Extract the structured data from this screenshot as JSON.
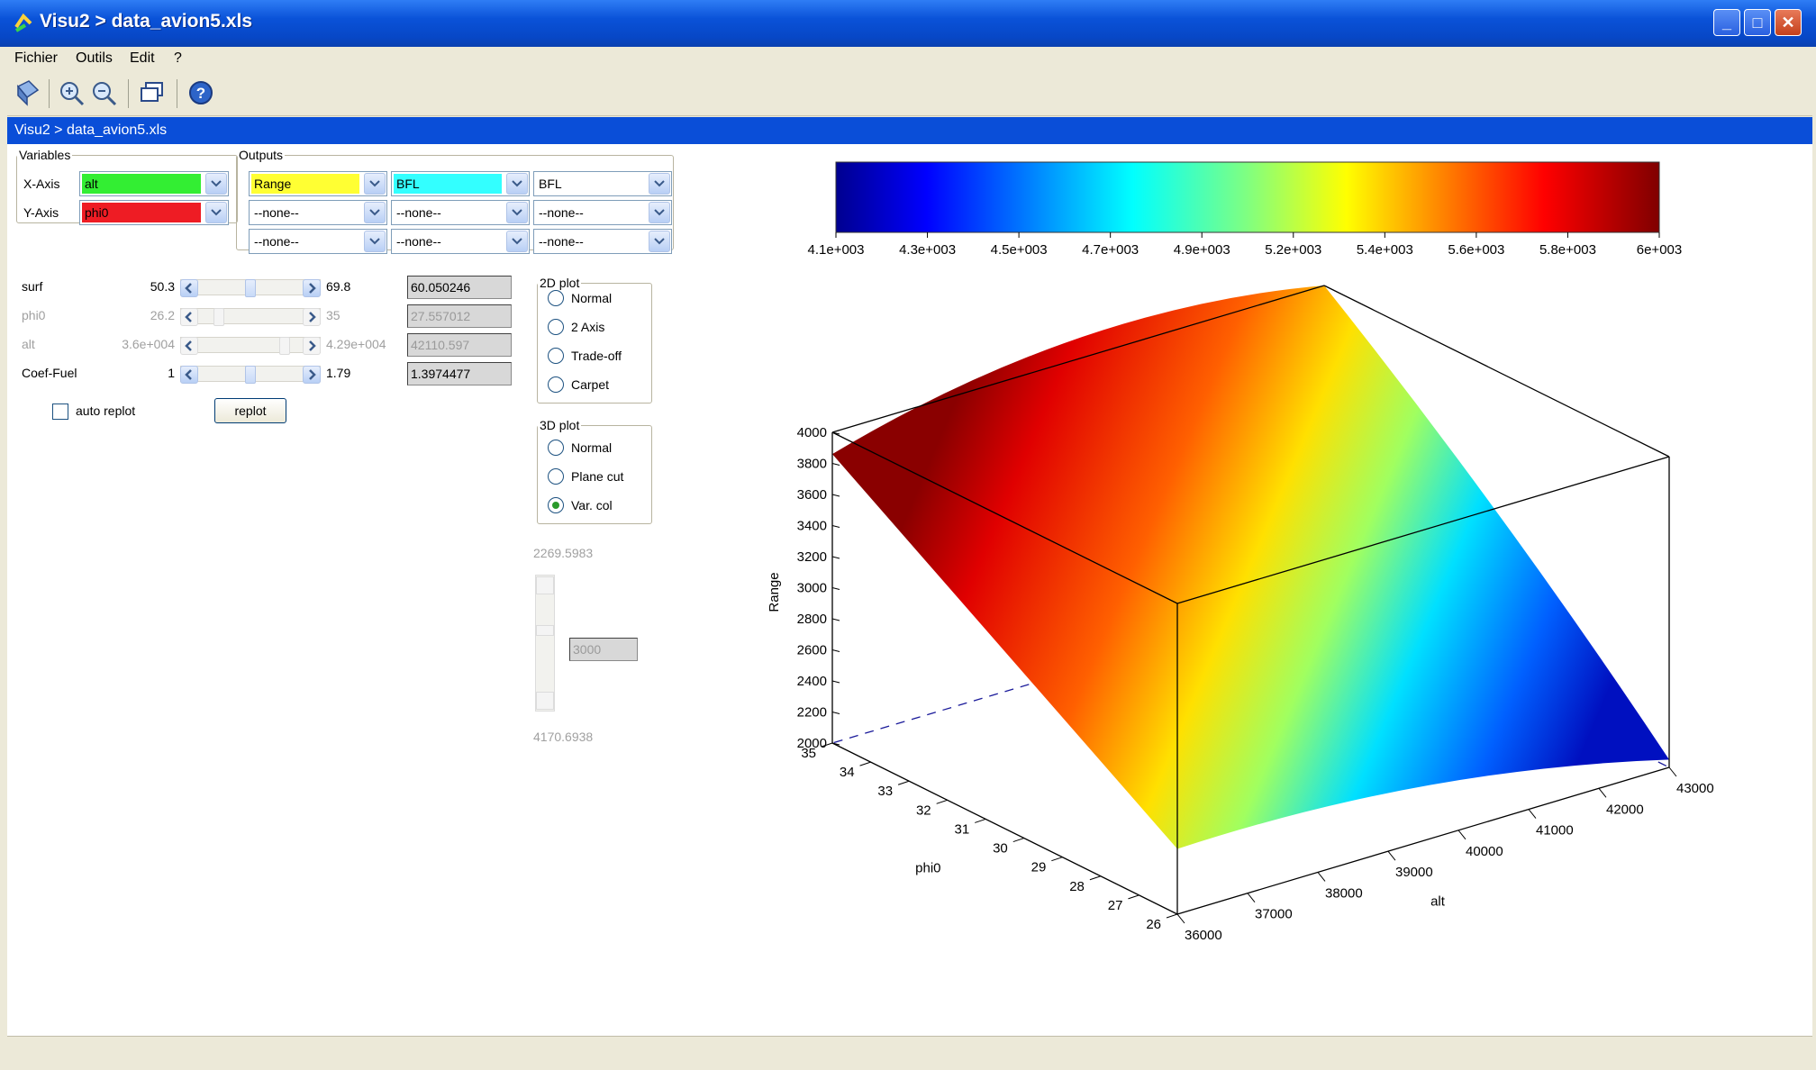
{
  "window": {
    "title": "Visu2 > data_avion5.xls",
    "path_bar": "Visu2 > data_avion5.xls",
    "controls": {
      "minimize": "_",
      "maximize": "□",
      "close": "✕"
    }
  },
  "menu": [
    "Fichier",
    "Outils",
    "Edit",
    "?"
  ],
  "toolbar": {
    "icons": [
      "tool-icon",
      "zoom-in-icon",
      "zoom-out-icon",
      "window-icon",
      "help-icon"
    ]
  },
  "variables": {
    "legend": "Variables",
    "x_label": "X-Axis",
    "x_value": "alt",
    "x_color": "#33ee33",
    "y_label": "Y-Axis",
    "y_value": "phi0",
    "y_color": "#ee1c24"
  },
  "outputs": {
    "legend": "Outputs",
    "cells": [
      [
        {
          "value": "Range",
          "color": "#ffff33"
        },
        {
          "value": "BFL",
          "color": "#33ffff"
        },
        {
          "value": "BFL",
          "color": "#ffffff"
        }
      ],
      [
        {
          "value": "--none--",
          "color": "#ffffff"
        },
        {
          "value": "--none--",
          "color": "#ffffff"
        },
        {
          "value": "--none--",
          "color": "#ffffff"
        }
      ],
      [
        {
          "value": "--none--",
          "color": "#ffffff"
        },
        {
          "value": "--none--",
          "color": "#ffffff"
        },
        {
          "value": "--none--",
          "color": "#ffffff"
        }
      ]
    ]
  },
  "params": [
    {
      "name": "surf",
      "min": "50.3",
      "max": "69.8",
      "value": "60.050246",
      "level": 0.5,
      "enabled": true
    },
    {
      "name": "phi0",
      "min": "26.2",
      "max": "35",
      "value": "27.557012",
      "level": 0.15,
      "enabled": false
    },
    {
      "name": "alt",
      "min": "3.6e+004",
      "max": "4.29e+004",
      "value": "42110.597",
      "level": 0.88,
      "enabled": false
    },
    {
      "name": "Coef-Fuel",
      "min": "1",
      "max": "1.79",
      "value": "1.3974477",
      "level": 0.5,
      "enabled": true
    }
  ],
  "auto_replot": {
    "label": "auto replot",
    "checked": false
  },
  "replot_button": "replot",
  "plot2d": {
    "legend": "2D plot",
    "options": [
      {
        "label": "Normal",
        "selected": false
      },
      {
        "label": "2 Axis",
        "selected": false
      },
      {
        "label": "Trade-off",
        "selected": false
      },
      {
        "label": "Carpet",
        "selected": false
      }
    ]
  },
  "plot3d": {
    "legend": "3D plot",
    "options": [
      {
        "label": "Normal",
        "selected": false
      },
      {
        "label": "Plane cut",
        "selected": false
      },
      {
        "label": "Var. col",
        "selected": true
      }
    ]
  },
  "vslider": {
    "top": "2269.5983",
    "bottom": "4170.6938",
    "value": "3000"
  },
  "chart_data": {
    "type": "surface",
    "x_label": "alt",
    "y_label": "phi0",
    "z_label": "Range",
    "x_ticks": [
      "36000",
      "37000",
      "38000",
      "39000",
      "40000",
      "41000",
      "42000",
      "43000"
    ],
    "y_ticks": [
      "26",
      "27",
      "28",
      "29",
      "30",
      "31",
      "32",
      "33",
      "34",
      "35"
    ],
    "z_ticks": [
      "2000",
      "2200",
      "2400",
      "2600",
      "2800",
      "3000",
      "3200",
      "3400",
      "3600",
      "3800",
      "4000"
    ],
    "xlim": [
      36000,
      43000
    ],
    "ylim": [
      26,
      35
    ],
    "zlim": [
      2000,
      4000
    ],
    "colorbar": {
      "ticks": [
        "4.1e+003",
        "4.3e+003",
        "4.5e+003",
        "4.7e+003",
        "4.9e+003",
        "5.2e+003",
        "5.4e+003",
        "5.6e+003",
        "5.8e+003",
        "6e+003"
      ],
      "colormap": "jet"
    },
    "surface_corners": {
      "alt36000_phi35": 3860,
      "alt43000_phi35": 4000,
      "alt36000_phi26": 2420,
      "alt43000_phi26": 2050
    }
  }
}
